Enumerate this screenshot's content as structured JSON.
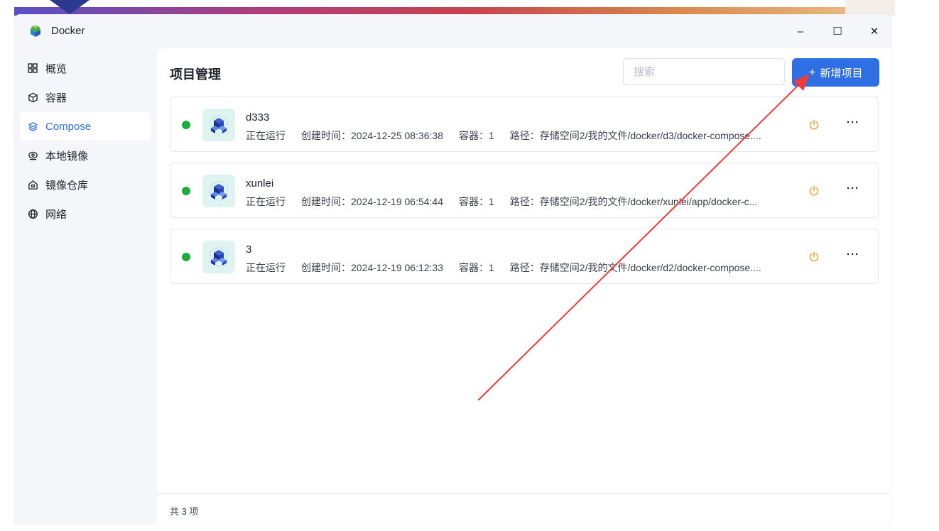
{
  "window": {
    "title": "Docker",
    "controls": {
      "minimize": "–",
      "maximize": "☐",
      "close": "✕"
    }
  },
  "sidebar": {
    "items": [
      {
        "label": "概览",
        "icon": "grid-icon",
        "active": false
      },
      {
        "label": "容器",
        "icon": "cube-icon",
        "active": false
      },
      {
        "label": "Compose",
        "icon": "layers-icon",
        "active": true
      },
      {
        "label": "本地镜像",
        "icon": "eye-disc-icon",
        "active": false
      },
      {
        "label": "镜像仓库",
        "icon": "house-icon",
        "active": false
      },
      {
        "label": "网络",
        "icon": "globe-icon",
        "active": false
      }
    ]
  },
  "main": {
    "title": "项目管理",
    "search": {
      "placeholder": "搜索",
      "value": ""
    },
    "add_button": {
      "icon": "+",
      "label": "新增项目"
    },
    "projects": [
      {
        "name": "d333",
        "status": "正在运行",
        "created": "创建时间：2024-12-25 08:36:38",
        "containers": "容器：1",
        "path": "路径：存储空间2/我的文件/docker/d3/docker-compose...."
      },
      {
        "name": "xunlei",
        "status": "正在运行",
        "created": "创建时间：2024-12-19 06:54:44",
        "containers": "容器：1",
        "path": "路径：存储空间2/我的文件/docker/xunlei/app/docker-c..."
      },
      {
        "name": "3",
        "status": "正在运行",
        "created": "创建时间：2024-12-19 06:12:33",
        "containers": "容器：1",
        "path": "路径：存储空间2/我的文件/docker/d2/docker-compose...."
      }
    ],
    "footer": {
      "count": "共 3 项"
    }
  },
  "colors": {
    "accent": "#2f6fe4",
    "running": "#1aaf3c",
    "power": "#f0a12a",
    "annotation_arrow": "#ef3b3b"
  }
}
